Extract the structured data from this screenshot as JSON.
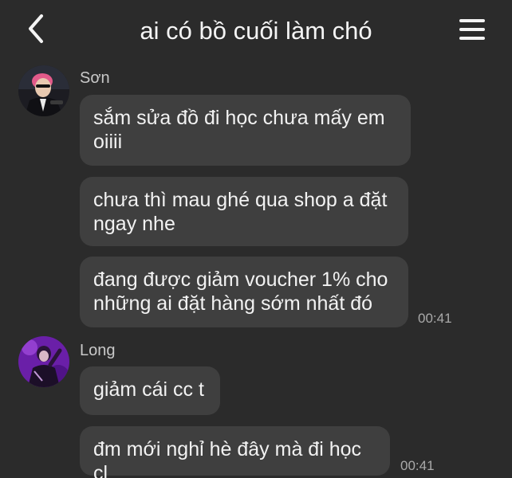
{
  "header": {
    "back_icon": "chevron-left-icon",
    "title": "ai có bồ cuối làm chó",
    "menu_icon": "hamburger-menu-icon"
  },
  "groups": [
    {
      "sender": "Sơn",
      "avatar": "avatar-son",
      "messages": [
        {
          "text": "sắm sửa đồ đi học chưa mấy em oiiii"
        },
        {
          "text": "chưa thì mau ghé qua shop a đặt ngay nhe"
        },
        {
          "text": "đang được giảm voucher 1% cho những ai đặt hàng sớm nhất đó"
        }
      ],
      "time": "00:41"
    },
    {
      "sender": "Long",
      "avatar": "avatar-long",
      "messages": [
        {
          "text": "giảm cái cc t"
        },
        {
          "text": "đm mới nghỉ hè đây mà đi học cl"
        }
      ],
      "time": "00:41"
    }
  ],
  "colors": {
    "background": "#2b2b2b",
    "bubble": "#3f3f3f",
    "text": "#f2f2f2",
    "muted": "#a9a9a9"
  }
}
